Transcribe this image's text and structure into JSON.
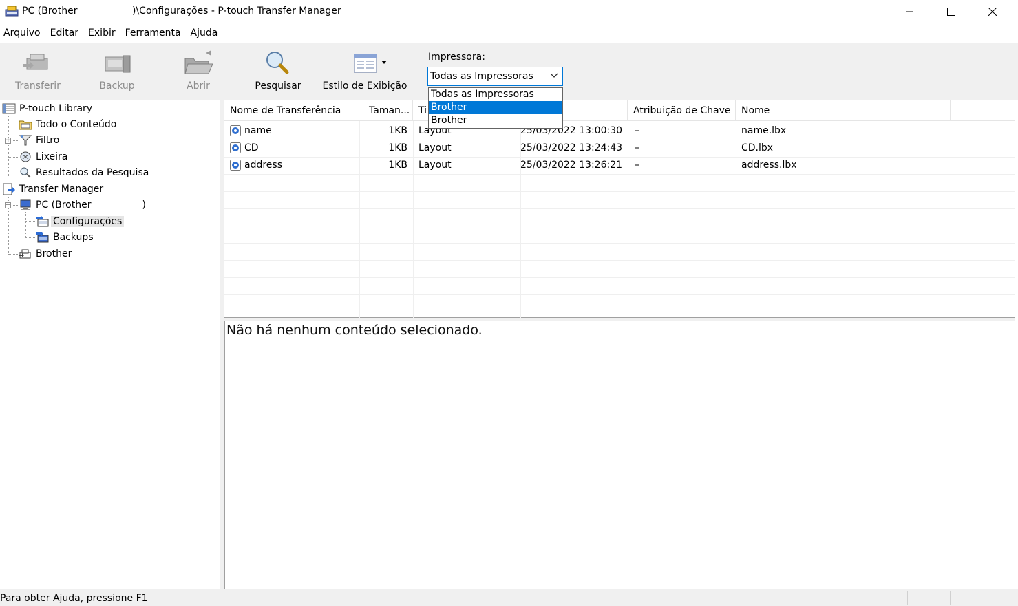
{
  "window": {
    "title_left": "PC (Brother",
    "title_right": ")\\Configurações - P-touch Transfer Manager"
  },
  "menu": [
    "Arquivo",
    "Editar",
    "Exibir",
    "Ferramenta",
    "Ajuda"
  ],
  "toolbar": {
    "transfer_label": "Transferir",
    "backup_label": "Backup",
    "open_label": "Abrir",
    "search_label": "Pesquisar",
    "view_style_label": "Estilo de Exibição",
    "printer_label": "Impressora:",
    "printer_value": "Todas as Impressoras",
    "printer_options": [
      "Todas as Impressoras",
      "Brother",
      "Brother"
    ],
    "printer_selected_index": 1
  },
  "tree": {
    "library": "P-touch Library",
    "all_content": "Todo o Conteúdo",
    "filter": "Filtro",
    "trash": "Lixeira",
    "search_results": "Resultados da Pesquisa",
    "transfer_manager": "Transfer Manager",
    "pc": "PC (Brother",
    "pc_suffix": ")",
    "configurations": "Configurações",
    "backups": "Backups",
    "brother": "Brother"
  },
  "list": {
    "columns": [
      "Nome de Transferência",
      "Taman...",
      "Ti",
      "",
      "Atribuição de Chave",
      "Nome"
    ],
    "rows": [
      {
        "name": "name",
        "size": "1KB",
        "type": "Layout",
        "date": "25/03/2022 13:00:30",
        "key": "–",
        "file": "name.lbx"
      },
      {
        "name": "CD",
        "size": "1KB",
        "type": "Layout",
        "date": "25/03/2022 13:24:43",
        "key": "–",
        "file": "CD.lbx"
      },
      {
        "name": "address",
        "size": "1KB",
        "type": "Layout",
        "date": "25/03/2022 13:26:21",
        "key": "–",
        "file": "address.lbx"
      }
    ]
  },
  "preview": {
    "message": "Não há nenhum conteúdo selecionado."
  },
  "status": {
    "text": "Para obter Ajuda, pressione F1"
  }
}
